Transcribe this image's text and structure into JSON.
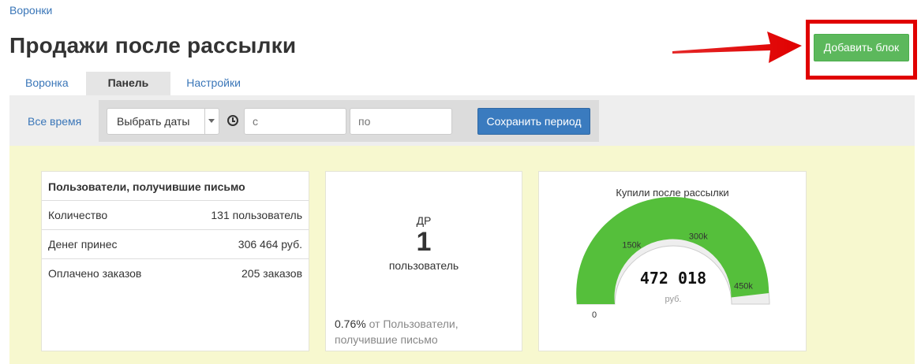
{
  "breadcrumb": "Воронки",
  "page_title": "Продажи после рассылки",
  "tabs": [
    {
      "label": "Воронка"
    },
    {
      "label": "Панель"
    },
    {
      "label": "Настройки"
    }
  ],
  "add_block_label": "Добавить блок",
  "period": {
    "all_time": "Все время",
    "select_dates": "Выбрать даты",
    "from_placeholder": "с",
    "to_placeholder": "по",
    "save_label": "Сохранить период"
  },
  "stats_card": {
    "title": "Пользователи, получившие письмо",
    "rows": [
      {
        "label": "Количество",
        "value": "131 пользователь"
      },
      {
        "label": "Денег принес",
        "value": "306 464 руб."
      },
      {
        "label": "Оплачено заказов",
        "value": "205 заказов"
      }
    ]
  },
  "counter_card": {
    "label": "ДР",
    "value": "1",
    "unit": "пользователь",
    "footer_pct": "0.76%",
    "footer_text": " от Пользователи, получившие письмо"
  },
  "gauge_card": {
    "title": "Купили после рассылки",
    "value_text": "472 018",
    "unit": "руб.",
    "min_label": "0",
    "tick_labels": [
      "150k",
      "300k",
      "450k"
    ],
    "min": 0,
    "max": 472018,
    "value": 472018
  },
  "colors": {
    "link": "#3a76b8",
    "primary_button": "#3a7bbf",
    "success_button": "#5cb85c",
    "gauge_fill": "#55bf3b",
    "dashboard_bg": "#f7f8cf",
    "highlight": "#e00000"
  }
}
